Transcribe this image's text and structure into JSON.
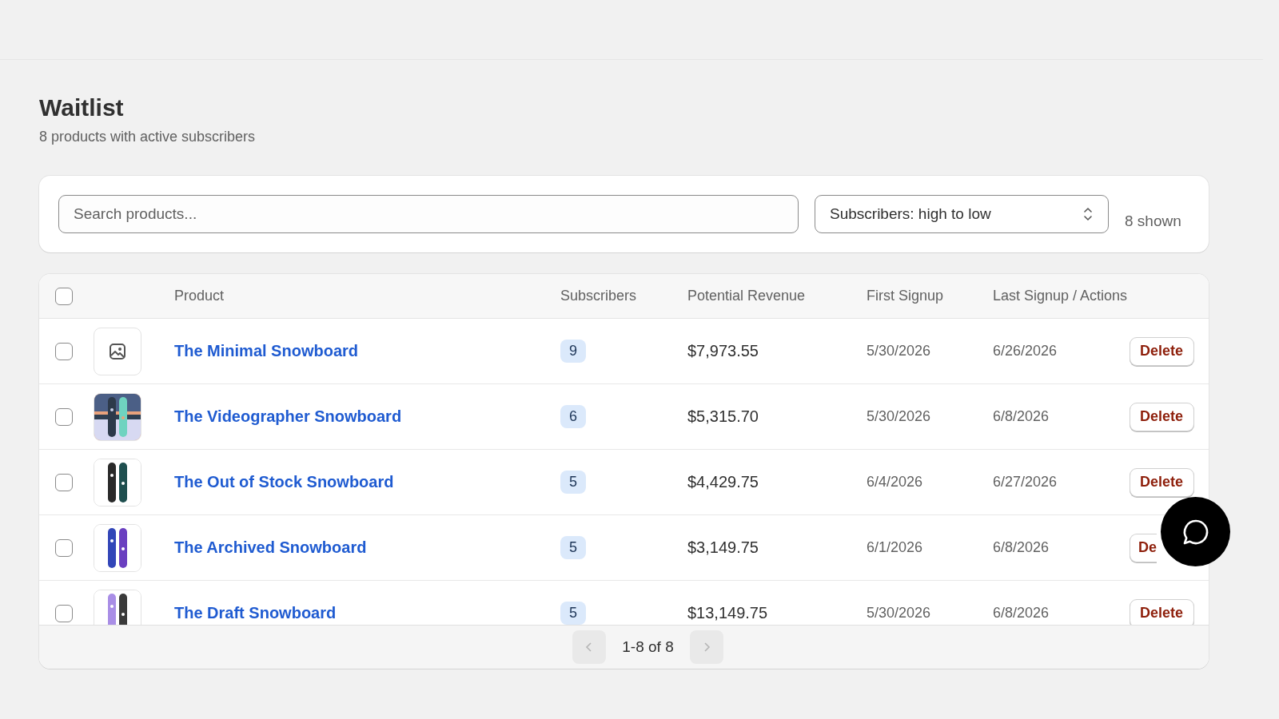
{
  "page": {
    "title": "Waitlist",
    "subtitle": "8 products with active subscribers"
  },
  "filters": {
    "search": {
      "placeholder": "Search products..."
    },
    "sort": {
      "value": "Subscribers: high to low"
    },
    "count": "8 shown"
  },
  "table": {
    "columns": [
      "Product",
      "Subscribers",
      "Potential Revenue",
      "First Signup",
      "Last Signup / Actions"
    ],
    "rows": [
      {
        "selected": false,
        "thumbnail": {
          "kind": "placeholder"
        },
        "product": "The Minimal Snowboard",
        "subscribers": "9",
        "revenue": "$7,973.55",
        "first_signup": "5/30/2026",
        "last_signup": "6/26/2026",
        "action": "Delete",
        "action_clipped": false
      },
      {
        "selected": false,
        "product": "The Videographer Snowboard",
        "subscribers": "6",
        "revenue": "$5,315.70",
        "first_signup": "5/30/2026",
        "last_signup": "6/8/2026",
        "action": "Delete",
        "action_clipped": false
      },
      {
        "selected": false,
        "product": "The Out of Stock Snowboard",
        "subscribers": "5",
        "revenue": "$4,429.75",
        "first_signup": "6/4/2026",
        "last_signup": "6/27/2026",
        "action": "Delete",
        "action_clipped": false
      },
      {
        "selected": false,
        "product": "The Archived Snowboard",
        "subscribers": "5",
        "revenue": "$3,149.75",
        "first_signup": "6/1/2026",
        "last_signup": "6/8/2026",
        "action": "De",
        "action_clipped": true
      },
      {
        "selected": false,
        "product": "The Draft Snowboard",
        "subscribers": "5",
        "revenue": "$13,149.75",
        "first_signup": "5/30/2026",
        "last_signup": "6/8/2026",
        "action": "Delete",
        "action_clipped": false
      }
    ],
    "select_all": {
      "checked": false
    }
  },
  "pagination": {
    "label": "1-8 of 8",
    "previous_disabled": true,
    "next_disabled": true
  }
}
